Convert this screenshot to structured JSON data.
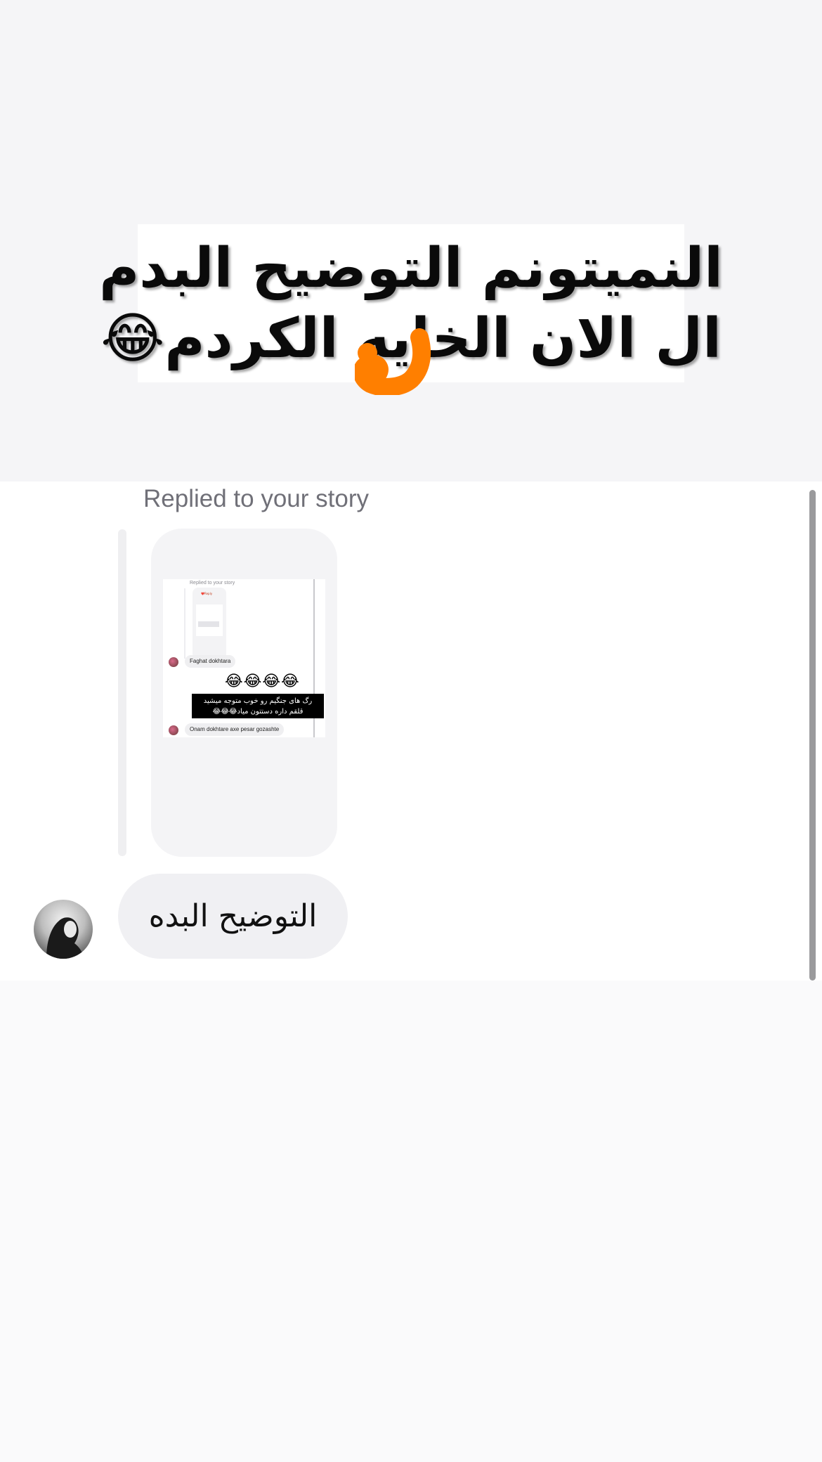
{
  "story_caption": {
    "line1": "النمیتونم التوضیح البدم",
    "line2": "ال الان الخایه الکردم😂"
  },
  "conversation": {
    "reply_context": "Replied to your story",
    "message_text": "التوضیح البده"
  },
  "story_preview": {
    "label": "Replied to your story",
    "heart_text": "❤️Reply",
    "messages": [
      "Faghat dokhtara",
      "Onam dokhtare axe pesar gozashte"
    ],
    "emojis": "😂😂😂😂",
    "overlay_line1": "رگ های جنگیم رو خوب متوجه میشید",
    "overlay_line2": "قلقم داره دستتون میاد😂😂😂"
  },
  "colors": {
    "scribble": "#ff7f00",
    "reply_label": "#707078",
    "bubble": "#f0f0f3"
  },
  "icons": {
    "avatar": "profile-avatar",
    "scribble": "orange-scribble"
  }
}
